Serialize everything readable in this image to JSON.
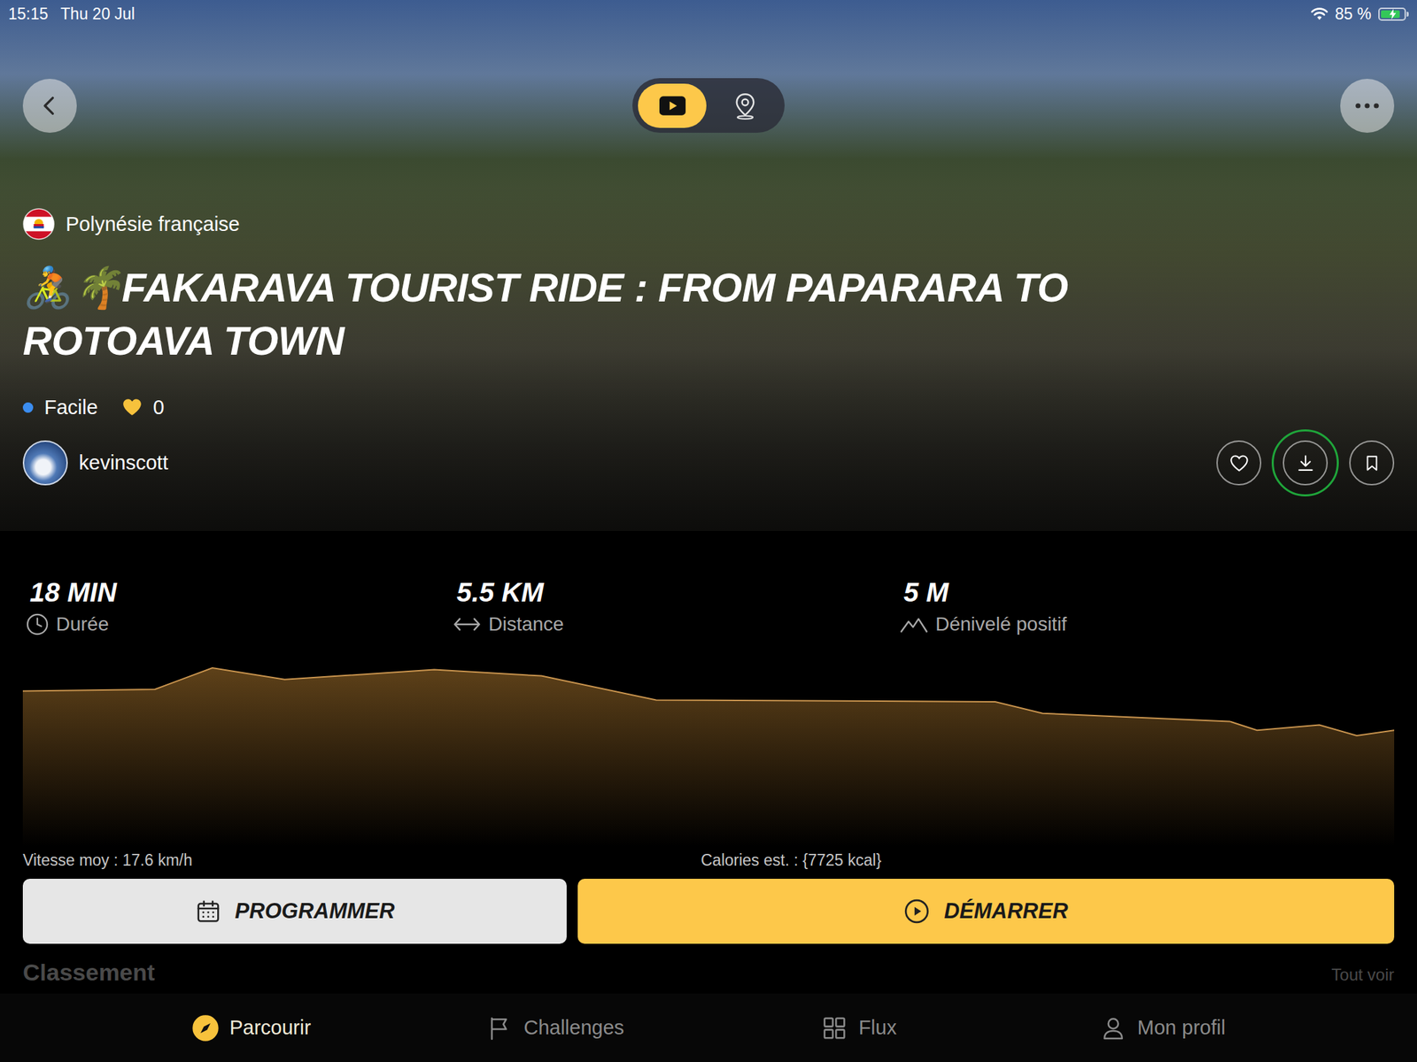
{
  "status_bar": {
    "time": "15:15",
    "date": "Thu 20 Jul",
    "battery": "85 %",
    "battery_level": 0.85,
    "charging": true
  },
  "view_toggle": [
    {
      "kind": "video",
      "selected": true
    },
    {
      "kind": "map",
      "selected": false
    }
  ],
  "ride": {
    "country": "Polynésie française",
    "title": "🚴🌴FAKARAVA TOURIST RIDE : FROM PAPARARA TO ROTOAVA TOWN",
    "difficulty": "Facile",
    "likes": "0",
    "author": "kevinscott"
  },
  "actions": [
    {
      "kind": "like",
      "highlighted": false
    },
    {
      "kind": "download",
      "highlighted": true
    },
    {
      "kind": "bookmark",
      "highlighted": false
    }
  ],
  "stats": [
    {
      "kind": "duration",
      "value": "18 MIN",
      "label": "Durée"
    },
    {
      "kind": "distance",
      "value": "5.5 KM",
      "label": "Distance"
    },
    {
      "kind": "elevation",
      "value": "5 M",
      "label": "Dénivelé positif"
    }
  ],
  "elevation_chart": {
    "distance_km": [
      0,
      0.53,
      0.76,
      1.05,
      1.65,
      2.08,
      2.54,
      3.9,
      4.09,
      4.84,
      4.95,
      5.2,
      5.35,
      5.5
    ],
    "elevation_m": [
      8.7,
      8.8,
      10,
      9.35,
      9.9,
      9.55,
      8.2,
      8.1,
      7.45,
      7.0,
      6.5,
      6.8,
      6.2,
      6.5
    ]
  },
  "average_speed": "Vitesse moy : 17.6 km/h",
  "calories": "Calories est. : {7725 kcal}",
  "buttons": [
    {
      "kind": "schedule",
      "label": "PROGRAMMER"
    },
    {
      "kind": "start",
      "label": "DÉMARRER"
    }
  ],
  "section": {
    "title": "Classement",
    "link": "Tout voir"
  },
  "tabs": [
    {
      "kind": "browse",
      "label": "Parcourir",
      "selected": true
    },
    {
      "kind": "challenges",
      "label": "Challenges",
      "selected": false
    },
    {
      "kind": "feed",
      "label": "Flux",
      "selected": false
    },
    {
      "kind": "profile",
      "label": "Mon profil",
      "selected": false
    }
  ]
}
